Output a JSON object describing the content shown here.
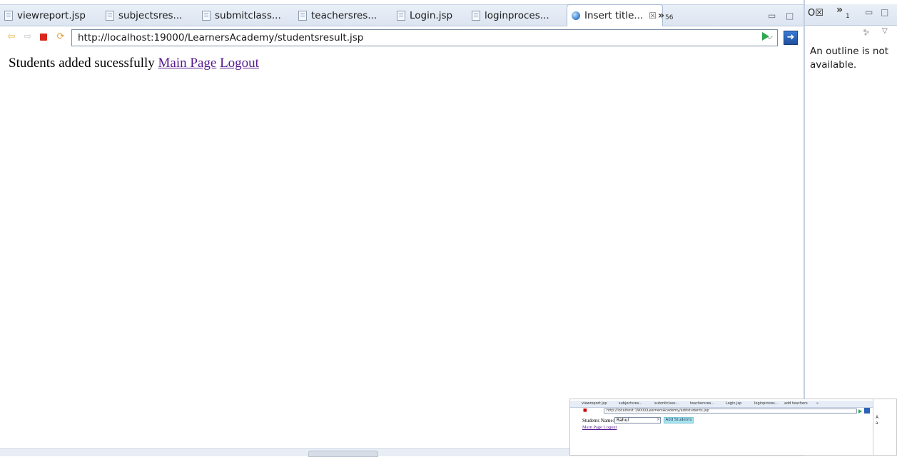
{
  "editor": {
    "tabs": [
      {
        "label": "viewreport.jsp",
        "icon": "file-icon"
      },
      {
        "label": "subjectsres...",
        "icon": "file-icon"
      },
      {
        "label": "submitclass...",
        "icon": "file-icon"
      },
      {
        "label": "teachersres...",
        "icon": "file-icon"
      },
      {
        "label": "Login.jsp",
        "icon": "file-icon"
      },
      {
        "label": "loginproces...",
        "icon": "file-icon"
      },
      {
        "label": "Insert title...",
        "icon": "globe-icon",
        "active": true,
        "close": "☒"
      }
    ],
    "overflow": {
      "chevron": "»",
      "count": "56"
    },
    "window_controls": {
      "minimize": "▭",
      "maximize": "□"
    },
    "browser": {
      "url": "http://localhost:19000/LearnersAcademy/studentsresult.jsp",
      "url_dropdown": "⌵"
    },
    "page": {
      "message": "Students added sucessfully",
      "links": [
        "Main Page",
        "Logout"
      ]
    }
  },
  "outline": {
    "tab_label": "O☒",
    "overflow": {
      "chevron": "»",
      "count": "1"
    },
    "message": "An outline is not available.",
    "window_controls": {
      "minimize": "▭",
      "maximize": "□"
    },
    "menu_dropdown": "▽"
  },
  "thumbnail": {
    "tabs": [
      "viewreport.jsp",
      "subjectsres...",
      "submitclass...",
      "teachersres...",
      "Login.jsp",
      "loginproces...",
      "add teachers",
      "»"
    ],
    "url": "http://localhost:19000/LearnersAcademy/addstudents.jsp",
    "label": "Students Name:",
    "input_value": "Rahul",
    "clear_mark": "×",
    "button_label": "Add Students",
    "links": "Main Page Logout",
    "side_text_1": "A",
    "side_text_2": "a"
  },
  "colors": {
    "link_visited": "#551a8b",
    "tab_bar": "#dce5f1",
    "go_green": "#2fa84f",
    "stop_red": "#d9271c",
    "thumb_button": "#a8e3ef"
  }
}
